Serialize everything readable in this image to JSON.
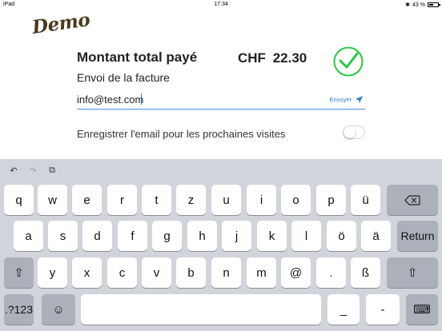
{
  "status_bar": {
    "device": "iPad",
    "time": "17:34",
    "bluetooth": "✱",
    "battery": "43 %"
  },
  "logo": {
    "text": "Demo"
  },
  "payment": {
    "total_label": "Montant total payé",
    "currency": "CHF",
    "amount": "22.30"
  },
  "invoice": {
    "title": "Envoi de la facture"
  },
  "email": {
    "value": "info@test.com",
    "send_label": "Envoyer"
  },
  "save_email": {
    "label": "Enregistrer l'email pour les prochaines visites",
    "enabled": false
  },
  "keyboard": {
    "toolbar": {
      "undo": "↶",
      "redo": "↷",
      "paste": "⧉"
    },
    "row1": [
      "q",
      "w",
      "e",
      "r",
      "t",
      "z",
      "u",
      "i",
      "o",
      "p",
      "ü"
    ],
    "row2": [
      "a",
      "s",
      "d",
      "f",
      "g",
      "h",
      "j",
      "k",
      "l",
      "ö",
      "ä"
    ],
    "row3": [
      "y",
      "x",
      "c",
      "v",
      "b",
      "n",
      "m",
      "@",
      ".",
      "ß"
    ],
    "backspace": "⌫",
    "return_label": "Return",
    "shift": "⇧",
    "numbers_label": ".?123",
    "emoji": "☺",
    "underscore": "_",
    "dash": "-",
    "dismiss": "⌨"
  },
  "colors": {
    "accent": "#2b7cd3",
    "check": "#28c840",
    "keyboard_bg": "#d1d4da"
  }
}
